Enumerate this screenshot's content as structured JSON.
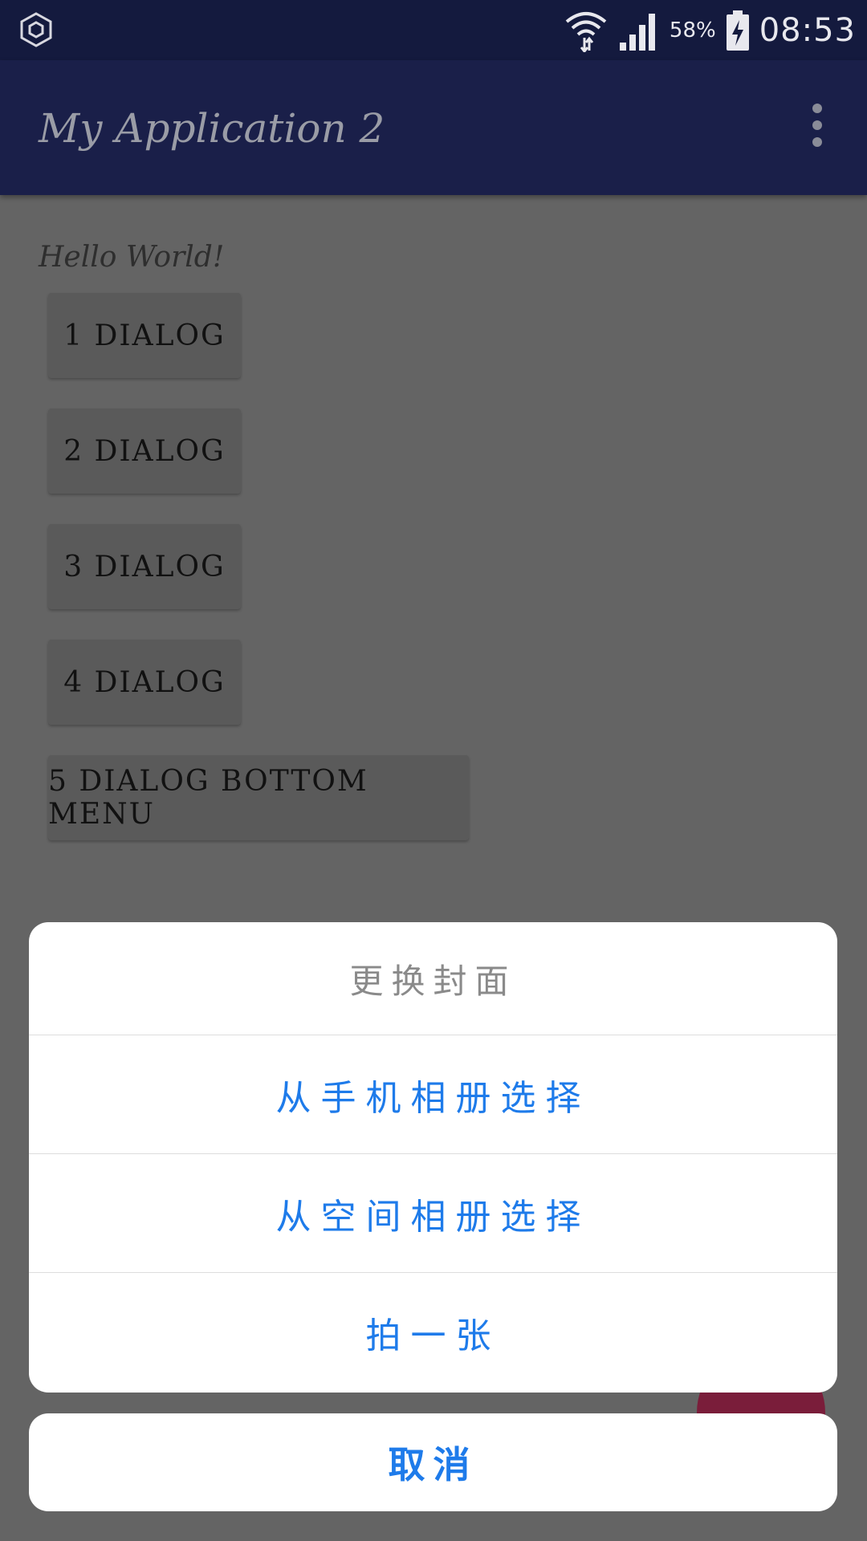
{
  "status_bar": {
    "battery_percent": "58%",
    "time": "08:53",
    "icons": [
      "hexagon-icon",
      "wifi-icon",
      "signal-icon",
      "battery-charging-icon"
    ]
  },
  "app_bar": {
    "title": "My Application 2",
    "menu_icon": "overflow-menu-icon"
  },
  "main": {
    "hello_text": "Hello World!",
    "buttons": [
      {
        "label": "1 DIALOG"
      },
      {
        "label": "2 DIALOG"
      },
      {
        "label": "3 DIALOG"
      },
      {
        "label": "4 DIALOG"
      },
      {
        "label": "5 DIALOG BOTTOM MENU"
      }
    ]
  },
  "bottom_sheet": {
    "title": "更换封面",
    "items": [
      {
        "label": "从手机相册选择"
      },
      {
        "label": "从空间相册选择"
      },
      {
        "label": "拍一张"
      }
    ],
    "cancel_label": "取消"
  },
  "colors": {
    "status_bar": "#141A3E",
    "app_bar": "#1A1F49",
    "dim_background": "#646464",
    "accent_text": "#1E7BEA",
    "fab": "#7A1D3A"
  }
}
